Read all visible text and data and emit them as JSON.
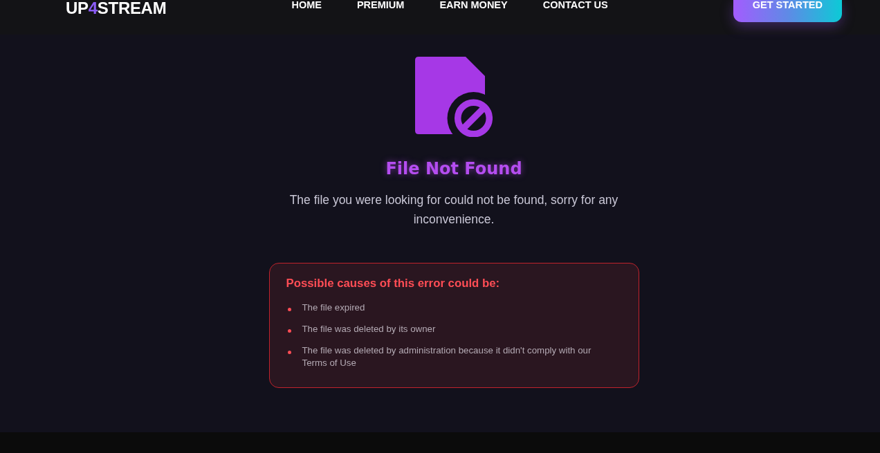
{
  "header": {
    "logo": {
      "before": "UP",
      "accent": "4",
      "after": "STREAM"
    },
    "nav": [
      {
        "label": "HOME"
      },
      {
        "label": "PREMIUM"
      },
      {
        "label": "EARN MONEY"
      },
      {
        "label": "CONTACT US"
      }
    ],
    "cta": "GET STARTED"
  },
  "error": {
    "title": "File Not Found",
    "message": "The file you were looking for could not be found, sorry for any inconvenience."
  },
  "causes": {
    "heading": "Possible causes of this error could be:",
    "items": [
      "The file expired",
      "The file was deleted by its owner",
      "The file was deleted by administration because it didn't comply with our Terms of Use"
    ]
  }
}
